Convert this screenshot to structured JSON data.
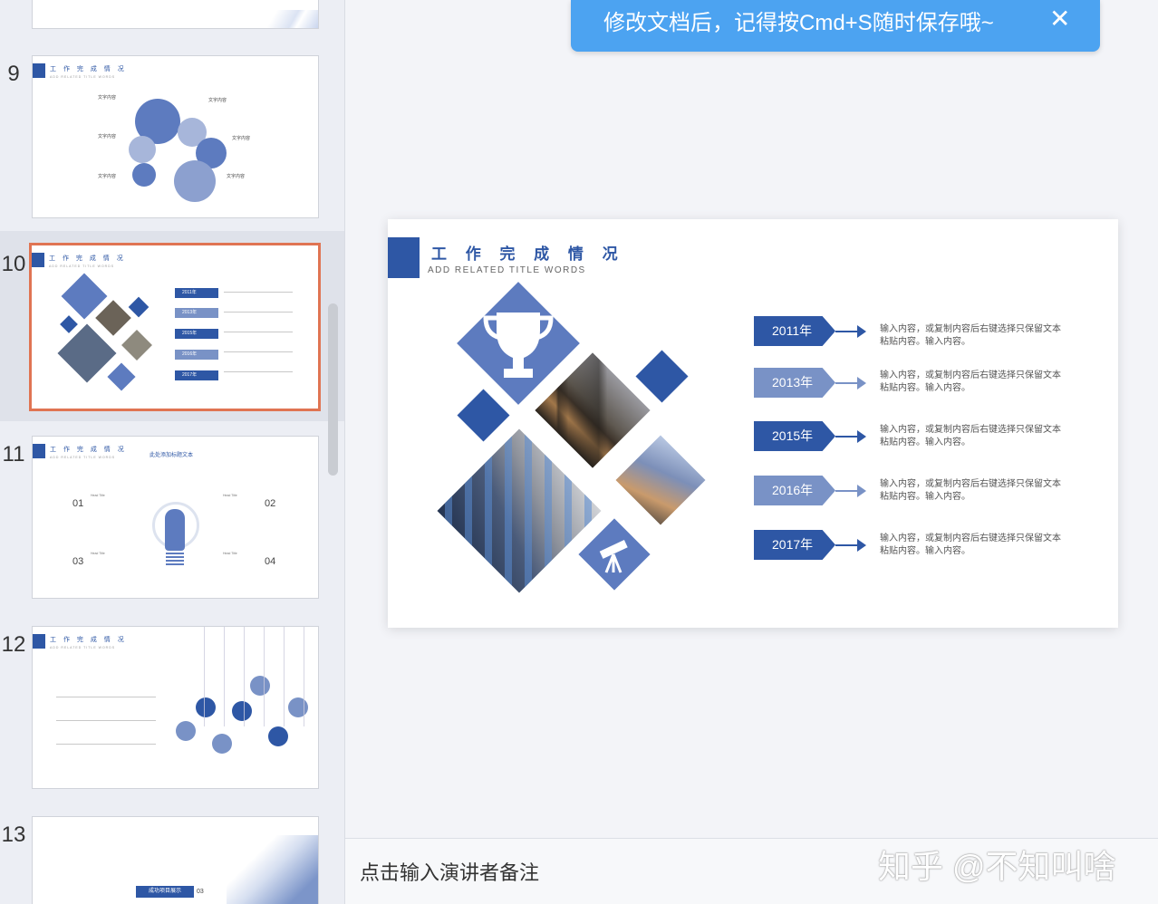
{
  "toast": {
    "message": "修改文档后，记得按Cmd+S随时保存哦~",
    "close_icon": "✕"
  },
  "thumbnails": [
    {
      "number": "9",
      "title": "工 作 完 成 情 况",
      "subtitle": "ADD RELATED TITLE WORDS",
      "items": [
        "文字内容",
        "文字内容",
        "文字内容",
        "文字内容",
        "文字内容",
        "文字内容"
      ]
    },
    {
      "number": "10",
      "title": "工 作 完 成 情 况",
      "subtitle": "ADD RELATED TITLE WORDS",
      "years": [
        "2011年",
        "2013年",
        "2015年",
        "2016年",
        "2017年"
      ]
    },
    {
      "number": "11",
      "title": "工 作 完 成 情 况",
      "subtitle": "ADD RELATED TITLE WORDS",
      "heading": "此处添加标题文本",
      "nums": [
        "01",
        "02",
        "03",
        "04"
      ],
      "head_title": "Head Title"
    },
    {
      "number": "12",
      "title": "工 作 完 成 情 况",
      "subtitle": "ADD RELATED TITLE WORDS"
    },
    {
      "number": "13",
      "label": "成功项目展示",
      "num": "03"
    }
  ],
  "slide": {
    "title": "工 作 完 成 情 况",
    "subtitle": "ADD RELATED TITLE WORDS",
    "rows": [
      {
        "year": "2011年",
        "style": "dark",
        "text": "输入内容，或复制内容后右键选择只保留文本粘贴内容。输入内容。"
      },
      {
        "year": "2013年",
        "style": "light",
        "text": "输入内容，或复制内容后右键选择只保留文本粘贴内容。输入内容。"
      },
      {
        "year": "2015年",
        "style": "dark",
        "text": "输入内容，或复制内容后右键选择只保留文本粘贴内容。输入内容。"
      },
      {
        "year": "2016年",
        "style": "light",
        "text": "输入内容，或复制内容后右键选择只保留文本粘贴内容。输入内容。"
      },
      {
        "year": "2017年",
        "style": "dark",
        "text": "输入内容，或复制内容后右键选择只保留文本粘贴内容。输入内容。"
      }
    ]
  },
  "notes": {
    "placeholder": "点击输入演讲者备注",
    "watermark": "知乎 @不知叫啥"
  },
  "colors": {
    "accent": "#2e57a5",
    "accent_light": "#7992c6",
    "selection": "#e07453",
    "toast": "#4ca3f1"
  }
}
